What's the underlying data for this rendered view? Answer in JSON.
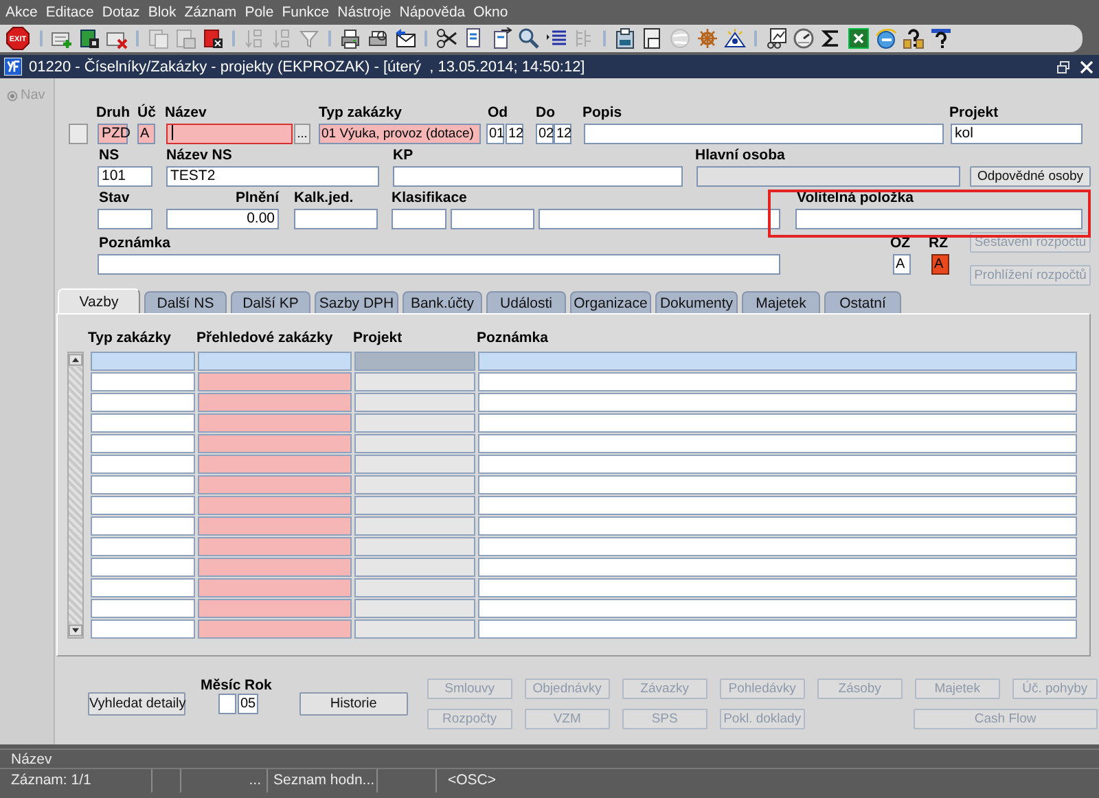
{
  "menu": [
    "Akce",
    "Editace",
    "Dotaz",
    "Blok",
    "Záznam",
    "Pole",
    "Funkce",
    "Nástroje",
    "Nápověda",
    "Okno"
  ],
  "toolbar": {
    "exit_label": "EXIT"
  },
  "window": {
    "title": "01220 - Číselníky/Zakázky - projekty (EKPROZAK) - [úterý  , 13.05.2014; 14:50:12]"
  },
  "nav": {
    "label": "Nav",
    "disabled": true
  },
  "form": {
    "record": {
      "checked": false
    },
    "druh": {
      "label": "Druh",
      "value": "PZD",
      "required": true
    },
    "uc": {
      "label": "Úč",
      "value": "A",
      "required": true
    },
    "nazev": {
      "label": "Název",
      "required": true,
      "focused": true,
      "lov": "..."
    },
    "typ_zakazky": {
      "label": "Typ zakázky",
      "value": "01 Výuka, provoz (dotace)",
      "required": true
    },
    "od": {
      "label": "Od",
      "values": [
        "01",
        "12"
      ]
    },
    "do": {
      "label": "Do",
      "values": [
        "02",
        "12"
      ]
    },
    "popis": {
      "label": "Popis"
    },
    "projekt": {
      "label": "Projekt",
      "value": "kol"
    },
    "ns": {
      "label": "NS",
      "value": "101"
    },
    "nazev_ns": {
      "label": "Název NS",
      "value": "TEST2"
    },
    "kp": {
      "label": "KP"
    },
    "hlavni_osoba": {
      "label": "Hlavní osoba",
      "disabled": true
    },
    "stav": {
      "label": "Stav"
    },
    "plneni": {
      "label": "Plnění",
      "value": "0.00"
    },
    "kalk_jed": {
      "label": "Kalk.jed."
    },
    "klasifikace": {
      "label": "Klasifikace"
    },
    "volitelna_polozka": {
      "label": "Volitelná položka"
    },
    "poznamka": {
      "label": "Poznámka"
    },
    "oz": {
      "label": "OZ",
      "value": "A",
      "flagged": false
    },
    "rz": {
      "label": "RZ",
      "value": "A",
      "flagged": true
    },
    "buttons": [
      {
        "label": "Odpovědné osoby",
        "disabled": false
      },
      {
        "label": "Sestavení rozpočtu",
        "disabled": true
      },
      {
        "label": "Prohlížení rozpočtů",
        "disabled": true
      }
    ]
  },
  "tabs": [
    {
      "label": "Vazby",
      "selected": true
    },
    {
      "label": "Další NS",
      "selected": false
    },
    {
      "label": "Další KP",
      "selected": false
    },
    {
      "label": "Sazby DPH",
      "selected": false
    },
    {
      "label": "Bank.účty",
      "selected": false
    },
    {
      "label": "Události",
      "selected": false
    },
    {
      "label": "Organizace",
      "selected": false
    },
    {
      "label": "Dokumenty",
      "selected": false
    },
    {
      "label": "Majetek",
      "selected": false
    },
    {
      "label": "Ostatní",
      "selected": false
    }
  ],
  "grid": {
    "columns": [
      {
        "label": "Typ zakázky",
        "required": false,
        "disabled": false
      },
      {
        "label": "Přehledové zakázky",
        "required": true,
        "disabled": false
      },
      {
        "label": "Projekt",
        "required": false,
        "disabled": true
      },
      {
        "label": "Poznámka",
        "required": false,
        "disabled": false
      }
    ],
    "rows": [
      {
        "selected": true
      },
      {
        "selected": false
      },
      {
        "selected": false
      },
      {
        "selected": false
      },
      {
        "selected": false
      },
      {
        "selected": false
      },
      {
        "selected": false
      },
      {
        "selected": false
      },
      {
        "selected": false
      },
      {
        "selected": false
      },
      {
        "selected": false
      },
      {
        "selected": false
      },
      {
        "selected": false
      },
      {
        "selected": false
      }
    ]
  },
  "bottom": {
    "search_button": "Vyhledat detaily",
    "month": {
      "label": "Měsíc"
    },
    "year": {
      "label": "Rok",
      "value": "05"
    },
    "history_button": "Historie",
    "actions": [
      [
        {
          "label": "Smlouvy",
          "disabled": true
        },
        {
          "label": "Objednávky",
          "disabled": true
        },
        {
          "label": "Závazky",
          "disabled": true
        },
        {
          "label": "Pohledávky",
          "disabled": true
        },
        {
          "label": "Zásoby",
          "disabled": true
        },
        {
          "label": "Majetek",
          "disabled": true
        },
        {
          "label": "Úč. pohyby",
          "disabled": true
        }
      ],
      [
        {
          "label": "Rozpočty",
          "disabled": true
        },
        {
          "label": "VZM",
          "disabled": true
        },
        {
          "label": "SPS",
          "disabled": true
        },
        {
          "label": "Pokl. doklady",
          "disabled": true
        },
        {
          "label": "Cash Flow",
          "disabled": true
        }
      ]
    ]
  },
  "status": {
    "item": "Název",
    "record": "Záznam: 1/1",
    "ellipsis": "...",
    "list": "Seznam hodn...",
    "mode": "<OSC>"
  }
}
